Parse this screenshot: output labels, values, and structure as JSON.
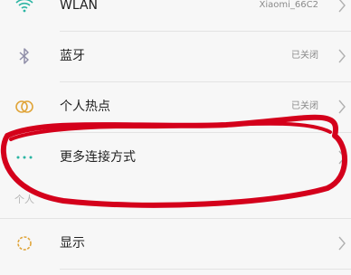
{
  "rows": [
    {
      "label": "WLAN",
      "value": "Xiaomi_66C2",
      "icon": "wifi-icon"
    },
    {
      "label": "蓝牙",
      "value": "已关闭",
      "icon": "bluetooth-icon"
    },
    {
      "label": "个人热点",
      "value": "已关闭",
      "icon": "hotspot-icon"
    },
    {
      "label": "更多连接方式",
      "icon": "more-dots-icon"
    },
    {
      "label": "显示",
      "icon": "display-icon"
    }
  ],
  "section_label": "个人",
  "colors": {
    "accent": "#2bb5a3",
    "annotation": "#d4001b"
  }
}
